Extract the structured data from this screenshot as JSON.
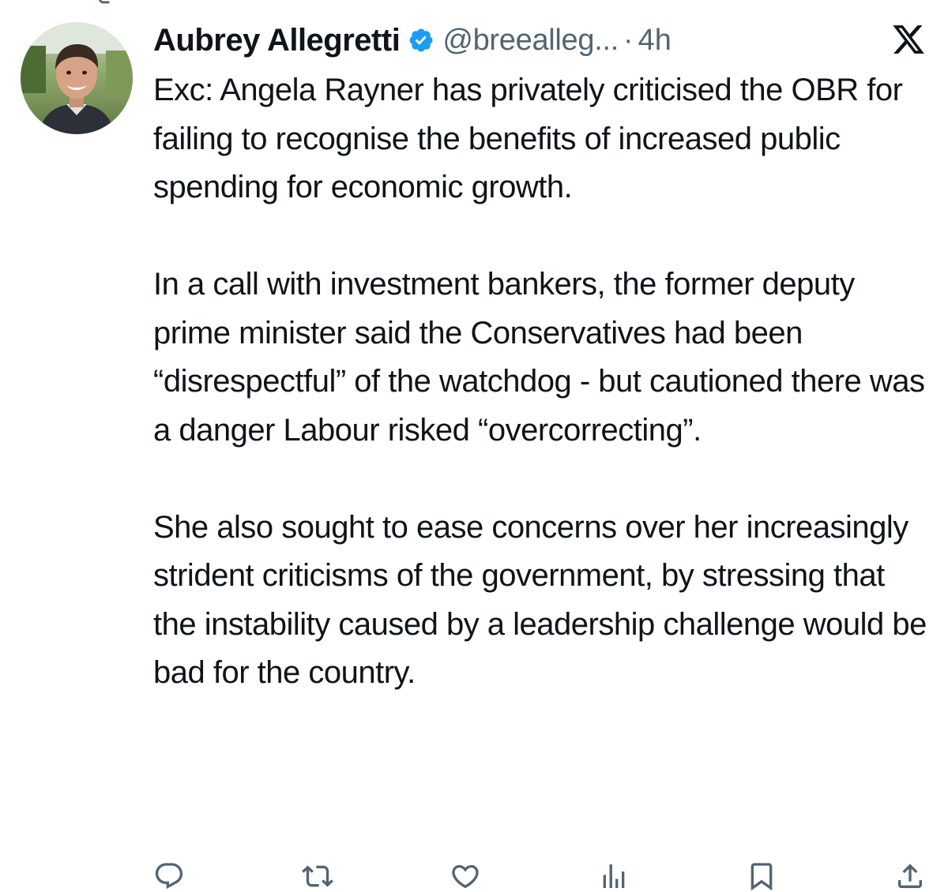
{
  "tweet": {
    "author_name": "Aubrey Allegretti",
    "handle": "@breealleg...",
    "separator": "·",
    "time": "4h",
    "paragraphs": [
      "Exc: Angela Rayner has privately criticised the OBR for failing to recognise the benefits of increased public spending for economic growth.",
      "In a call with investment bankers, the former deputy prime minister said the Conservatives had been “disrespectful” of the watchdog - but cautioned there was a danger Labour risked “overcorrecting”.",
      "She also sought to ease concerns over her increasingly strident criticisms of the government, by stressing that the instability caused by a leadership challenge would be bad for the country."
    ]
  },
  "icons": {
    "verified": "verified-badge-icon",
    "platform": "x-logo-icon",
    "reply": "reply-icon",
    "repost": "repost-icon",
    "like": "like-icon",
    "views": "views-icon",
    "bookmark": "bookmark-icon",
    "share": "share-icon",
    "repost_context": "repost-context-icon"
  },
  "colors": {
    "text": "#0f1419",
    "secondary": "#536471",
    "verified_blue": "#1d9bf0"
  }
}
